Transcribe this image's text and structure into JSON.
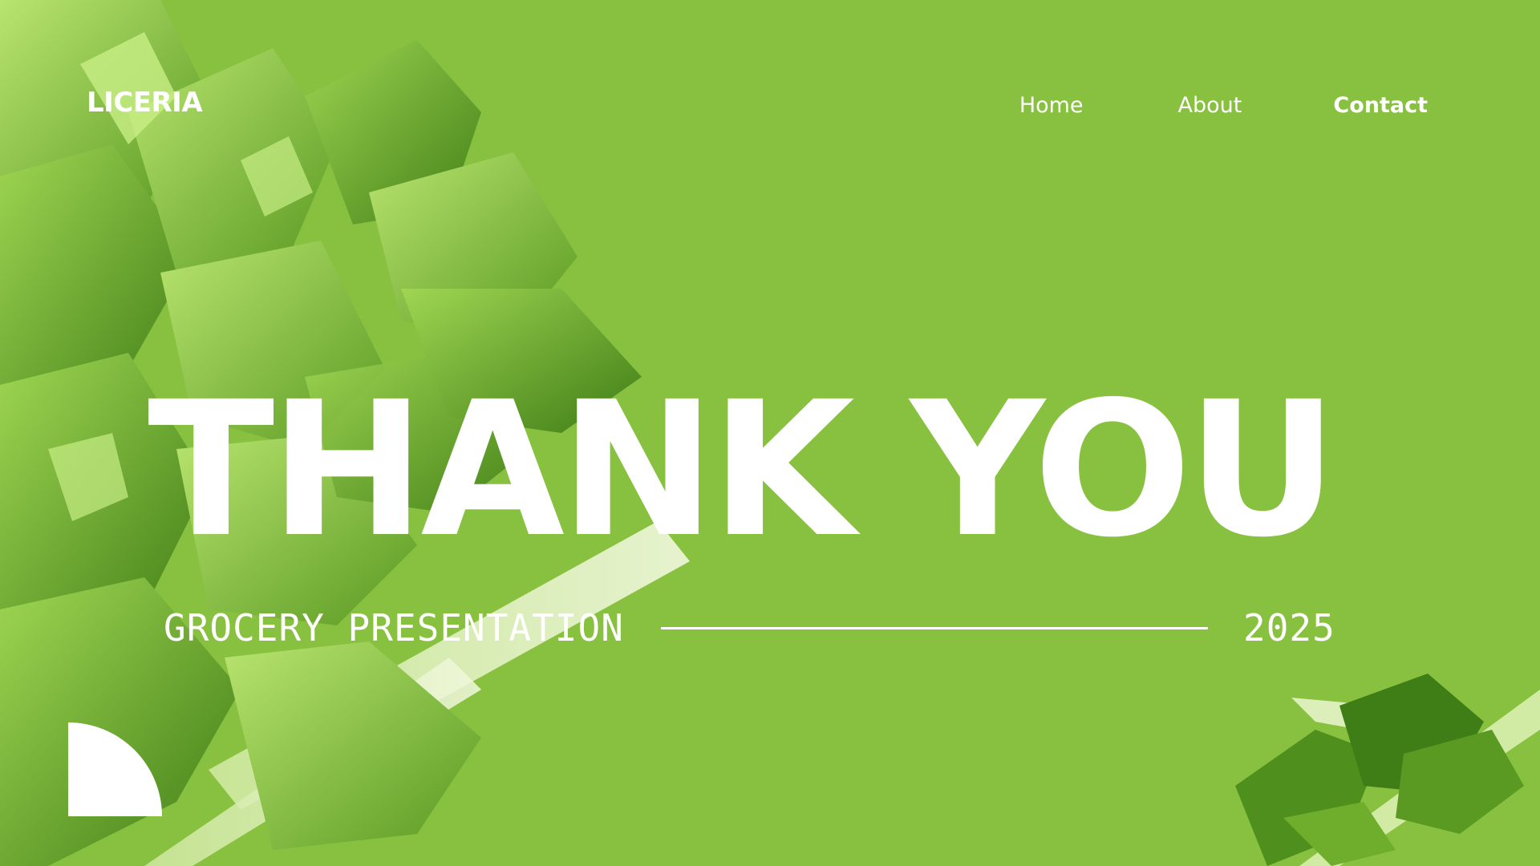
{
  "header": {
    "logo": "LICERIA",
    "nav": {
      "home": "Home",
      "about": "About",
      "contact": "Contact"
    }
  },
  "main": {
    "title": "THANK YOU",
    "subtitle": "GROCERY PRESENTATION",
    "year": "2025"
  },
  "colors": {
    "background": "#88c13f",
    "text": "#ffffff",
    "leaf_light": "#a6d85a",
    "leaf_mid": "#6fae2c",
    "leaf_dark": "#4f8f1d",
    "stalk": "#d9efb0"
  },
  "images": {
    "left": "celery-leaves-image",
    "right": "celery-sprig-image"
  }
}
